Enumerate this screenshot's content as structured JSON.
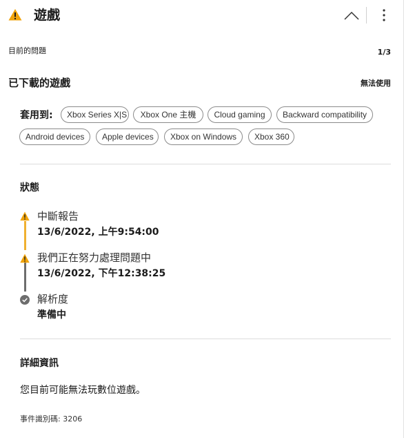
{
  "header": {
    "title": "遊戲",
    "collapse_icon": "chevron-up-icon",
    "more_icon": "more-vertical-icon",
    "warning_icon": "warning-icon"
  },
  "issue": {
    "label": "目前的問題",
    "count": "1/3"
  },
  "game": {
    "title": "已下載的遊戲",
    "status": "無法使用"
  },
  "applies": {
    "label": "套用到:",
    "tags": [
      "Xbox Series X|S",
      "Xbox One 主機",
      "Cloud gaming",
      "Backward compatibility",
      "Android devices",
      "Apple devices",
      "Xbox on Windows",
      "Xbox 360"
    ]
  },
  "status_section": {
    "heading": "狀態",
    "timeline": [
      {
        "title": "中斷報告",
        "sub_date": "13/6/2022, ",
        "sub_time": "上午9:54:00",
        "icon": "warning-icon"
      },
      {
        "title": "我們正在努力處理問題中",
        "sub_date": "13/6/2022, ",
        "sub_time": "下午12:38:25",
        "icon": "warning-icon"
      },
      {
        "title": "解析度",
        "sub_date": "",
        "sub_time": "準備中",
        "icon": "check-circle-icon"
      }
    ]
  },
  "details": {
    "heading": "詳細資訊",
    "text": "您目前可能無法玩數位遊戲。",
    "event_id": "事件識別碼: 3206"
  },
  "colors": {
    "warning": "#f0a30a",
    "warning_line": "#f0b030",
    "grey_line": "#6d6d6d",
    "check": "#6d6d6d"
  }
}
